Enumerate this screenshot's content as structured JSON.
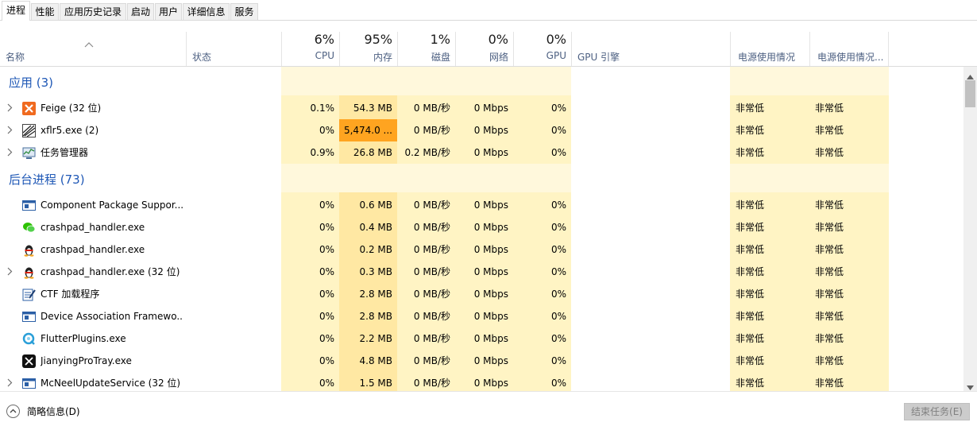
{
  "tabs": [
    {
      "label": "进程",
      "active": true
    },
    {
      "label": "性能"
    },
    {
      "label": "应用历史记录"
    },
    {
      "label": "启动"
    },
    {
      "label": "用户"
    },
    {
      "label": "详细信息"
    },
    {
      "label": "服务"
    }
  ],
  "header": {
    "name_label": "名称",
    "status_label": "状态",
    "cpu": {
      "pct": "6%",
      "label": "CPU"
    },
    "memory": {
      "pct": "95%",
      "label": "内存"
    },
    "disk": {
      "pct": "1%",
      "label": "磁盘"
    },
    "network": {
      "pct": "0%",
      "label": "网络"
    },
    "gpu": {
      "pct": "0%",
      "label": "GPU"
    },
    "gpu_engine_label": "GPU 引擎",
    "power_label": "电源使用情况",
    "power_trend_label": "电源使用情况..."
  },
  "groups": {
    "apps": {
      "title": "应用 (3)"
    },
    "background": {
      "title": "后台进程 (73)"
    }
  },
  "apps": [
    {
      "name": "Feige (32 位)",
      "icon": "feige-icon",
      "expandable": true,
      "cpu": "0.1%",
      "mem": "54.3 MB",
      "disk": "0 MB/秒",
      "net": "0 Mbps",
      "gpu": "0%",
      "power": "非常低",
      "power_trend": "非常低"
    },
    {
      "name": "xflr5.exe (2)",
      "icon": "xflr5-icon",
      "expandable": true,
      "cpu": "0%",
      "mem": "5,474.0 ...",
      "disk": "0 MB/秒",
      "net": "0 Mbps",
      "gpu": "0%",
      "power": "非常低",
      "power_trend": "非常低"
    },
    {
      "name": "任务管理器",
      "icon": "task-manager-icon",
      "expandable": true,
      "cpu": "0.9%",
      "mem": "26.8 MB",
      "disk": "0.2 MB/秒",
      "net": "0 Mbps",
      "gpu": "0%",
      "power": "非常低",
      "power_trend": "非常低"
    }
  ],
  "background": [
    {
      "name": "Component Package Suppor...",
      "icon": "window-app-icon",
      "expandable": false,
      "cpu": "0%",
      "mem": "0.6 MB",
      "disk": "0 MB/秒",
      "net": "0 Mbps",
      "gpu": "0%",
      "power": "非常低",
      "power_trend": "非常低"
    },
    {
      "name": "crashpad_handler.exe",
      "icon": "wechat-icon",
      "expandable": false,
      "cpu": "0%",
      "mem": "0.4 MB",
      "disk": "0 MB/秒",
      "net": "0 Mbps",
      "gpu": "0%",
      "power": "非常低",
      "power_trend": "非常低"
    },
    {
      "name": "crashpad_handler.exe",
      "icon": "qq-penguin-icon",
      "expandable": false,
      "cpu": "0%",
      "mem": "0.2 MB",
      "disk": "0 MB/秒",
      "net": "0 Mbps",
      "gpu": "0%",
      "power": "非常低",
      "power_trend": "非常低"
    },
    {
      "name": "crashpad_handler.exe (32 位)",
      "icon": "qq-penguin-icon",
      "expandable": true,
      "cpu": "0%",
      "mem": "0.3 MB",
      "disk": "0 MB/秒",
      "net": "0 Mbps",
      "gpu": "0%",
      "power": "非常低",
      "power_trend": "非常低"
    },
    {
      "name": "CTF 加载程序",
      "icon": "ctf-loader-icon",
      "expandable": false,
      "cpu": "0%",
      "mem": "2.8 MB",
      "disk": "0 MB/秒",
      "net": "0 Mbps",
      "gpu": "0%",
      "power": "非常低",
      "power_trend": "非常低"
    },
    {
      "name": "Device Association Framewo...",
      "icon": "window-app-icon",
      "expandable": false,
      "cpu": "0%",
      "mem": "2.8 MB",
      "disk": "0 MB/秒",
      "net": "0 Mbps",
      "gpu": "0%",
      "power": "非常低",
      "power_trend": "非常低"
    },
    {
      "name": "FlutterPlugins.exe",
      "icon": "flutter-plugins-icon",
      "expandable": false,
      "cpu": "0%",
      "mem": "2.2 MB",
      "disk": "0 MB/秒",
      "net": "0 Mbps",
      "gpu": "0%",
      "power": "非常低",
      "power_trend": "非常低"
    },
    {
      "name": "JianyingProTray.exe",
      "icon": "jianying-icon",
      "expandable": false,
      "cpu": "0%",
      "mem": "4.8 MB",
      "disk": "0 MB/秒",
      "net": "0 Mbps",
      "gpu": "0%",
      "power": "非常低",
      "power_trend": "非常低"
    },
    {
      "name": "McNeelUpdateService (32 位)",
      "icon": "window-app-icon",
      "expandable": true,
      "cpu": "0%",
      "mem": "1.5 MB",
      "disk": "0 MB/秒",
      "net": "0 Mbps",
      "gpu": "0%",
      "power": "非常低",
      "power_trend": "非常低"
    }
  ],
  "footer": {
    "fewer_details_label": "简略信息(D)",
    "end_task_label": "结束任务(E)"
  },
  "colors": {
    "heat_light": "#fff4c4",
    "heat_medium": "#ffe8a3",
    "heat_high": "#ffa420",
    "group_title": "#1f58b6"
  }
}
